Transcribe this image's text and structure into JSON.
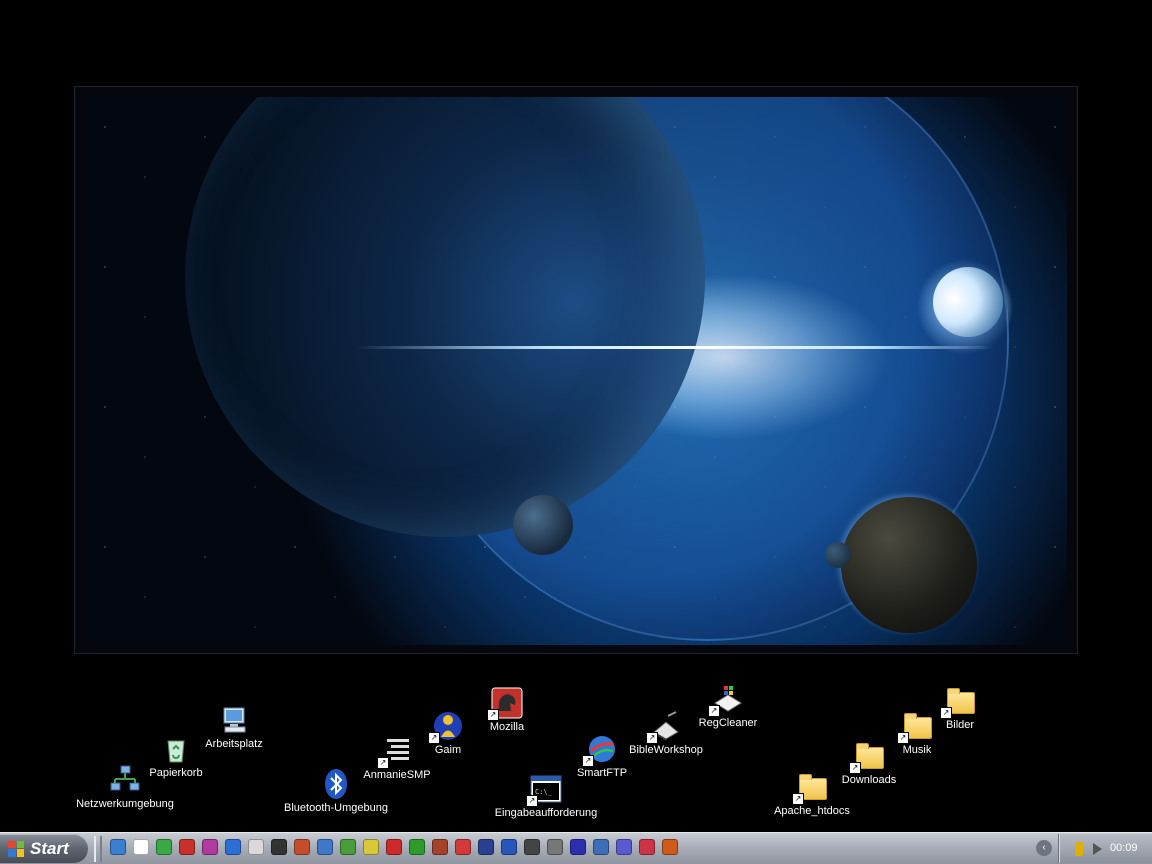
{
  "desktop": {
    "icons": [
      {
        "label": "Arbeitsplatz",
        "icon": "computer-icon",
        "shortcut": false
      },
      {
        "label": "Papierkorb",
        "icon": "recycle-bin-icon",
        "shortcut": false
      },
      {
        "label": "Netzwerkumgebung",
        "icon": "network-icon",
        "shortcut": false
      },
      {
        "label": "Bluetooth-Umgebung",
        "icon": "bluetooth-icon",
        "shortcut": false
      },
      {
        "label": "AnmanieSMP",
        "icon": "smp-icon",
        "shortcut": true
      },
      {
        "label": "Gaim",
        "icon": "gaim-icon",
        "shortcut": true
      },
      {
        "label": "Mozilla",
        "icon": "mozilla-icon",
        "shortcut": true
      },
      {
        "label": "Eingabeaufforderung",
        "icon": "command-prompt-icon",
        "shortcut": true
      },
      {
        "label": "SmartFTP",
        "icon": "smartftp-icon",
        "shortcut": true
      },
      {
        "label": "BibleWorkshop",
        "icon": "bibleworkshop-icon",
        "shortcut": true
      },
      {
        "label": "RegCleaner",
        "icon": "regcleaner-icon",
        "shortcut": true
      },
      {
        "label": "Apache_htdocs",
        "icon": "folder-icon",
        "shortcut": true
      },
      {
        "label": "Downloads",
        "icon": "folder-icon",
        "shortcut": true
      },
      {
        "label": "Musik",
        "icon": "folder-icon",
        "shortcut": true
      },
      {
        "label": "Bilder",
        "icon": "folder-icon",
        "shortcut": true
      }
    ]
  },
  "taskbar": {
    "start_label": "Start",
    "clock": "00:09",
    "tray_expand_glyph": "‹",
    "quick_launch_colors": [
      "#3b7fd1",
      "#ffffff",
      "#3aa845",
      "#c8302a",
      "#b03aa0",
      "#2b6fd6",
      "#d9d9d9",
      "#333333",
      "#c44d2b",
      "#3f78c9",
      "#4a9b3a",
      "#d8c93a",
      "#cf2a2a",
      "#2c9b2c",
      "#a4432a",
      "#d23a3a",
      "#2a3f8f",
      "#2855b8",
      "#444444",
      "#777777",
      "#2a2fb0",
      "#3c6fb5",
      "#5a5ad0",
      "#cc3344",
      "#d05a1a"
    ]
  }
}
